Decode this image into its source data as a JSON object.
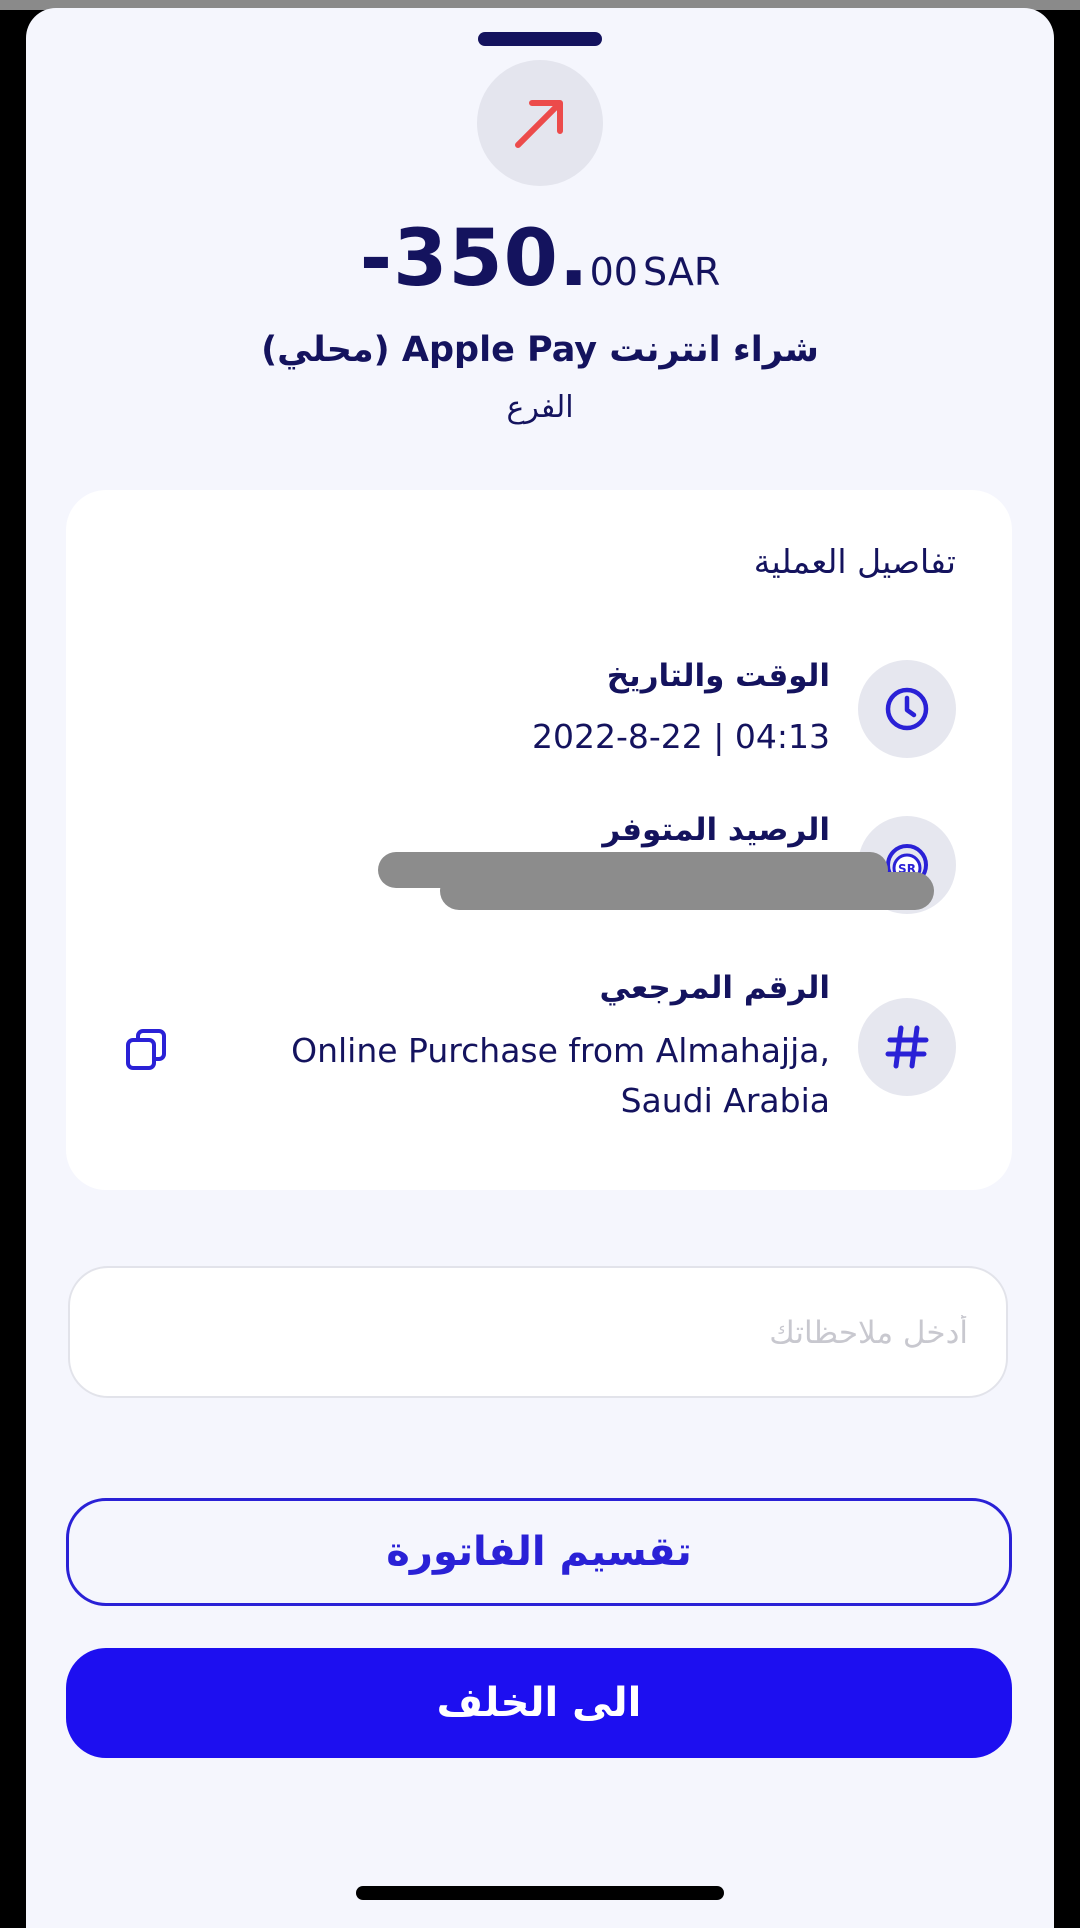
{
  "header": {
    "amount_main": "-350.",
    "amount_cents": "00",
    "currency": "SAR",
    "title": "شراء انترنت Apple Pay (محلي)",
    "subtitle": "الفرع"
  },
  "details": {
    "title": "تفاصيل العملية",
    "rows": [
      {
        "label": "الوقت والتاريخ",
        "value": "2022-8-22   |   04:13",
        "icon": "clock-icon"
      },
      {
        "label": "الرصيد المتوفر",
        "value": "",
        "icon": "sar-coin-icon"
      },
      {
        "label": "الرقم المرجعي",
        "value_line1": "Online Purchase from Almahajja,",
        "value_line2": "Saudi Arabia",
        "icon": "hash-icon"
      }
    ]
  },
  "notes": {
    "placeholder": "أدخل ملاحظاتك"
  },
  "buttons": {
    "split_label": "تقسيم الفاتورة",
    "back_label": "الى الخلف"
  },
  "colors": {
    "navy": "#14135e",
    "accent": "#2a21d6",
    "primary_button": "#1d0ff0",
    "arrow_red": "#ec4b4b"
  }
}
